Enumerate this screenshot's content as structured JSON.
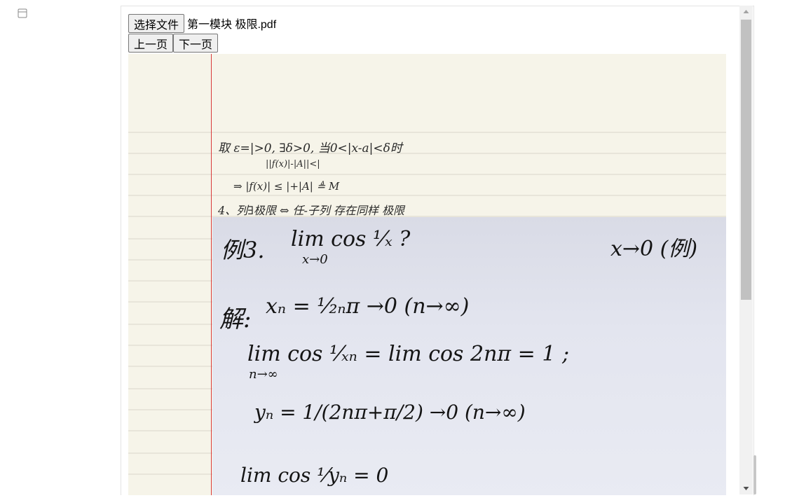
{
  "toolbar": {
    "choose_file_label": "选择文件",
    "file_name": "第一模块 极限.pdf",
    "prev_page_label": "上一页",
    "next_page_label": "下一页"
  },
  "sidebar": {
    "icon": "panel-icon"
  },
  "notes": {
    "line1": "取 ε=|>0, ∃δ>0, 当0<|x-a|<δ时",
    "line2": "||f(x)|-|A||<|",
    "line3": "⇒ |f(x)| ≤ |+|A| ≜ M",
    "line4": "4、列∃极限 ⇔ 任-子列 存在同样 极限"
  },
  "photo": {
    "example_title": "例3.",
    "example_expr": "lim  cos ¹⁄ₓ ?",
    "example_sub": "x→0",
    "example_right": "x→0 (例)",
    "sol_label": "解:",
    "sol_line1": "xₙ = ¹⁄₂ₙπ →0 (n→∞)",
    "sol_line2": "lim cos ¹⁄ₓₙ  =  lim cos 2nπ = 1 ;",
    "sol_line2_sub": "n→∞",
    "sol_line3": "yₙ = 1/(2nπ+π/2) →0 (n→∞)",
    "sol_line4": "lim cos ¹⁄yₙ  = 0"
  },
  "colors": {
    "paper": "#f6f4e9",
    "ruled_line": "#d9d6cc",
    "margin_line": "#d93a3a",
    "scroll_thumb": "#c1c1c1"
  }
}
